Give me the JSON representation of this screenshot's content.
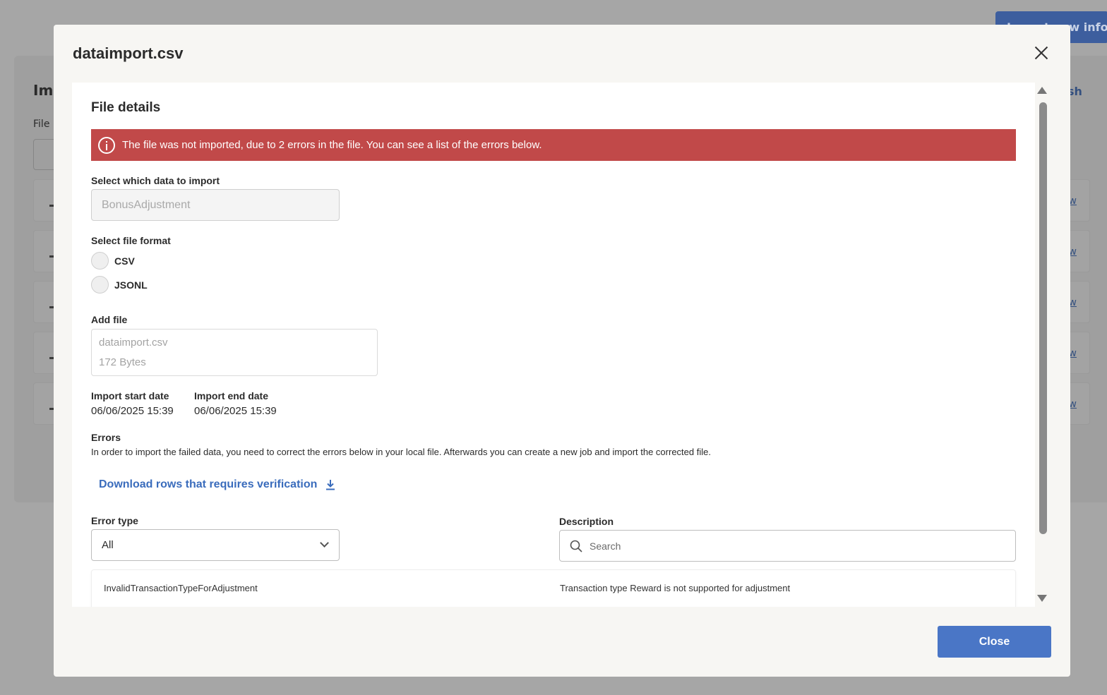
{
  "background": {
    "top_button_label": "Import new info",
    "panel_title": "Im",
    "refresh_label": "sh",
    "file_label": "File",
    "row_link_label": "w",
    "row_count": 5
  },
  "modal": {
    "title": "dataimport.csv",
    "section_title": "File details",
    "alert": {
      "text": "The file was not imported, due to 2 errors in the file. You can see a list of the errors below.",
      "color": "#c14949"
    },
    "data_select": {
      "label": "Select which data to import",
      "value": "BonusAdjustment"
    },
    "file_format": {
      "label": "Select file format",
      "options": [
        "CSV",
        "JSONL"
      ]
    },
    "add_file": {
      "label": "Add file",
      "file_name": "dataimport.csv",
      "file_size": "172 Bytes"
    },
    "dates": {
      "start_label": "Import start date",
      "start_value": "06/06/2025 15:39",
      "end_label": "Import end date",
      "end_value": "06/06/2025 15:39"
    },
    "errors": {
      "label": "Errors",
      "description": "In order to import the failed data, you need to correct the errors below in your local file. Afterwards you can create a new job and import the corrected file.",
      "download_label": "Download rows that requires verification"
    },
    "filters": {
      "error_type_label": "Error type",
      "error_type_value": "All",
      "description_label": "Description",
      "search_placeholder": "Search"
    },
    "rows": [
      {
        "error_type": "InvalidTransactionTypeForAdjustment",
        "description": "Transaction type Reward is not supported for adjustment"
      }
    ],
    "close_button_label": "Close",
    "accent_color": "#4a76c6"
  }
}
